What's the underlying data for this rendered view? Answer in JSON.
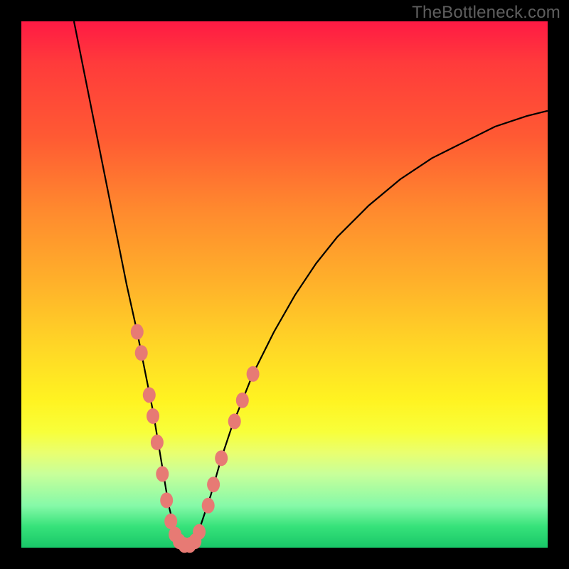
{
  "watermark": "TheBottleneck.com",
  "chart_data": {
    "type": "line",
    "title": "",
    "xlabel": "",
    "ylabel": "",
    "xlim": [
      0,
      100
    ],
    "ylim": [
      0,
      100
    ],
    "note": "V-shaped bottleneck curve over rainbow gradient. Axes/ticks not shown in source image; x treated as horizontal position 0–100, y as bottleneck percentage 0 (bottom/green) to 100 (top/red). Values estimated from pixel positions.",
    "series": [
      {
        "name": "bottleneck-curve",
        "x": [
          10,
          12,
          14,
          16,
          18,
          20,
          22,
          23,
          24,
          25,
          26,
          27,
          28,
          29,
          30,
          31,
          32,
          33,
          34,
          36,
          38,
          40,
          44,
          48,
          52,
          56,
          60,
          66,
          72,
          78,
          84,
          90,
          96,
          100
        ],
        "y": [
          100,
          90,
          80,
          70,
          60,
          50,
          41,
          36,
          31,
          26,
          20,
          14,
          8,
          4,
          1,
          0,
          0,
          1,
          4,
          10,
          17,
          23,
          33,
          41,
          48,
          54,
          59,
          65,
          70,
          74,
          77,
          80,
          82,
          83
        ]
      }
    ],
    "markers": {
      "name": "highlighted-points",
      "color": "#e77a74",
      "points": [
        {
          "x": 22.0,
          "y": 41
        },
        {
          "x": 22.8,
          "y": 37
        },
        {
          "x": 24.3,
          "y": 29
        },
        {
          "x": 25.0,
          "y": 25
        },
        {
          "x": 25.8,
          "y": 20
        },
        {
          "x": 26.8,
          "y": 14
        },
        {
          "x": 27.6,
          "y": 9
        },
        {
          "x": 28.4,
          "y": 5
        },
        {
          "x": 29.2,
          "y": 2.5
        },
        {
          "x": 30.0,
          "y": 1.2
        },
        {
          "x": 31.0,
          "y": 0.5
        },
        {
          "x": 32.0,
          "y": 0.5
        },
        {
          "x": 33.0,
          "y": 1.2
        },
        {
          "x": 33.8,
          "y": 3
        },
        {
          "x": 35.5,
          "y": 8
        },
        {
          "x": 36.5,
          "y": 12
        },
        {
          "x": 38.0,
          "y": 17
        },
        {
          "x": 40.5,
          "y": 24
        },
        {
          "x": 42.0,
          "y": 28
        },
        {
          "x": 44.0,
          "y": 33
        }
      ]
    },
    "gradient_stops": [
      {
        "pos": 0,
        "color": "#ff1a44"
      },
      {
        "pos": 22,
        "color": "#ff5a33"
      },
      {
        "pos": 50,
        "color": "#ffb22a"
      },
      {
        "pos": 72,
        "color": "#fff321"
      },
      {
        "pos": 100,
        "color": "#19c768"
      }
    ]
  }
}
